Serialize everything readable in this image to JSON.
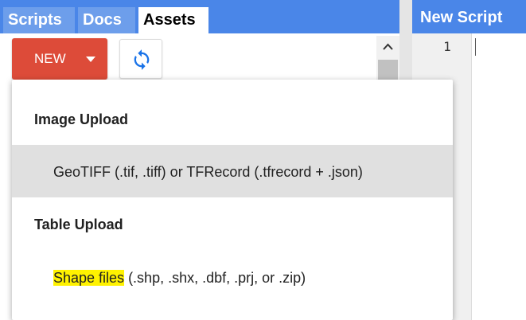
{
  "left_tabs": {
    "scripts": "Scripts",
    "docs": "Docs",
    "assets": "Assets"
  },
  "toolbar": {
    "new_label": "NEW",
    "refresh_icon": "refresh-icon"
  },
  "editor": {
    "title": "New Script",
    "line_numbers": [
      "1"
    ]
  },
  "menu": {
    "image_heading": "Image Upload",
    "image_item": "GeoTIFF (.tif, .tiff) or TFRecord (.tfrecord + .json)",
    "table_heading": "Table Upload",
    "table_item_highlight": "Shape files",
    "table_item_rest": " (.shp, .shx, .dbf, .prj, or .zip)"
  },
  "colors": {
    "tab_bar": "#4a86e8",
    "new_button": "#dd4b39",
    "refresh_icon": "#1a73e8",
    "highlight": "#fff200",
    "hover_row": "#e0e0e0"
  }
}
